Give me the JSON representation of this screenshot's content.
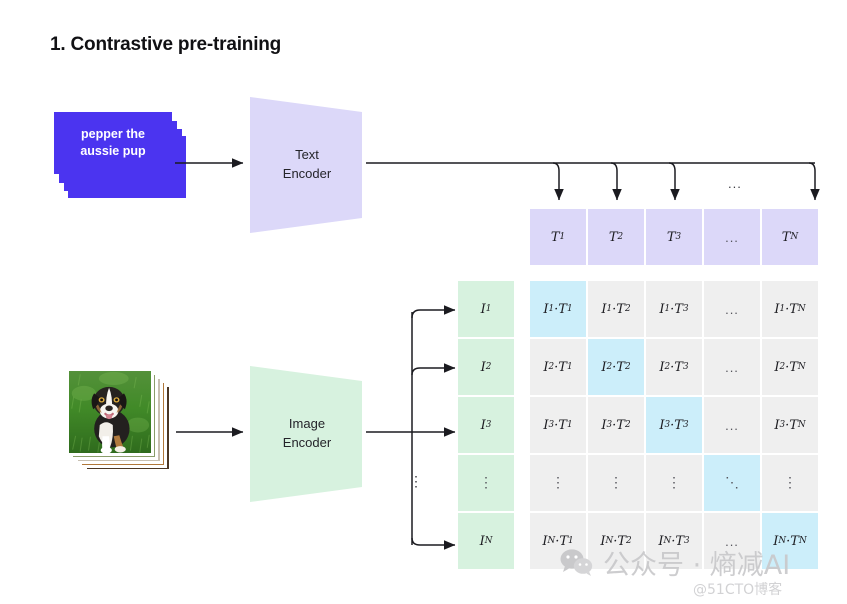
{
  "title": "1. Contrastive pre-training",
  "text_input": {
    "caption_line1": "pepper the",
    "caption_line2": "aussie pup",
    "card_color": "#4B34F0"
  },
  "image_input": {
    "alt": "australian-shepherd-puppy-photo"
  },
  "encoders": {
    "text": {
      "line1": "Text",
      "line2": "Encoder",
      "color": "#DCD8F9"
    },
    "image": {
      "line1": "Image",
      "line2": "Encoder",
      "color": "#D7F2DF"
    }
  },
  "grid": {
    "ellipsis": "...",
    "vertical_ellipsis": "⋮",
    "diagonal_ellipsis": "⋱",
    "text_embeddings": [
      {
        "base": "T",
        "sub": "1"
      },
      {
        "base": "T",
        "sub": "2"
      },
      {
        "base": "T",
        "sub": "3"
      },
      {
        "base": "",
        "sub": ""
      },
      {
        "base": "T",
        "sub": "N"
      }
    ],
    "text_embedding_labels": [
      "T1",
      "T2",
      "T3",
      "...",
      "TN"
    ],
    "image_embeddings": [
      {
        "base": "I",
        "sub": "1"
      },
      {
        "base": "I",
        "sub": "2"
      },
      {
        "base": "I",
        "sub": "3"
      },
      {
        "base": "",
        "sub": ""
      },
      {
        "base": "I",
        "sub": "N"
      }
    ],
    "image_embedding_labels": [
      "I1",
      "I2",
      "I3",
      "⋮",
      "IN"
    ],
    "row_keys": [
      "1",
      "2",
      "3",
      "dots",
      "N"
    ],
    "col_keys": [
      "1",
      "2",
      "3",
      "dots",
      "N"
    ],
    "dot_operator": "·",
    "matrix": [
      [
        "I1·T1",
        "I1·T2",
        "I1·T3",
        "...",
        "I1·TN"
      ],
      [
        "I2·T1",
        "I2·T2",
        "I2·T3",
        "...",
        "I2·TN"
      ],
      [
        "I3·T1",
        "I3·T2",
        "I3·T3",
        "...",
        "I3·TN"
      ],
      [
        "⋮",
        "⋮",
        "⋮",
        "⋱",
        "⋮"
      ],
      [
        "IN·T1",
        "IN·T2",
        "IN·T3",
        "...",
        "IN·TN"
      ]
    ],
    "highlight_color": "#CCEEFA",
    "cell_color": "#EFEFEF",
    "text_cell_color": "#DCD8F9",
    "image_cell_color": "#D7F2DF"
  },
  "watermark": {
    "main": "公众号 · 熵减AI",
    "sub": "@51CTO博客"
  }
}
